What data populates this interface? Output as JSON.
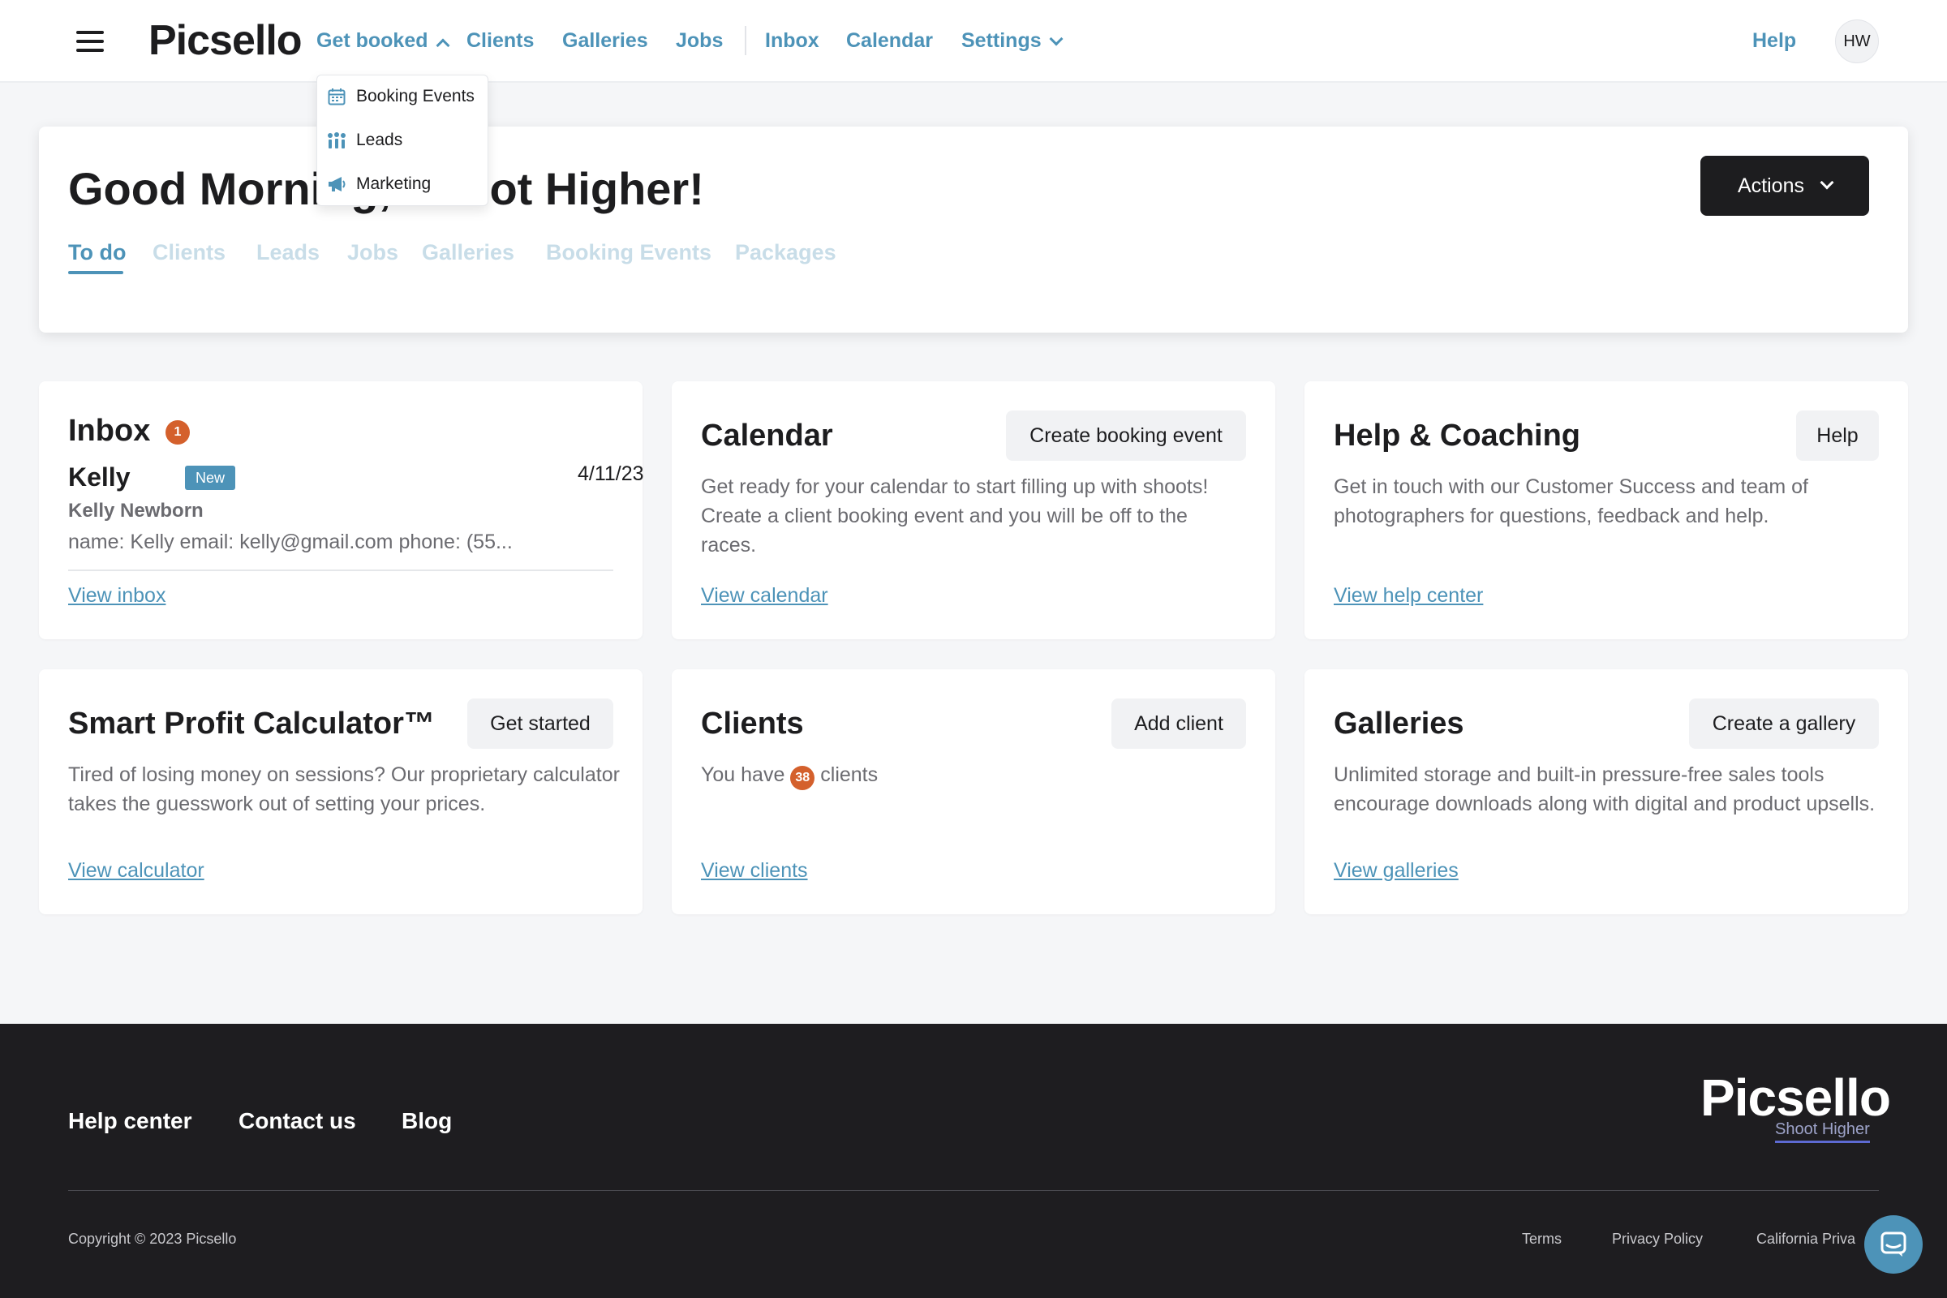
{
  "app": {
    "logo": "Picsello"
  },
  "nav": {
    "items": [
      {
        "label": "Get booked"
      },
      {
        "label": "Clients"
      },
      {
        "label": "Galleries"
      },
      {
        "label": "Jobs"
      },
      {
        "label": "Inbox"
      },
      {
        "label": "Calendar"
      },
      {
        "label": "Settings"
      }
    ],
    "help": "Help",
    "avatar_initials": "HW"
  },
  "dropdown": {
    "items": [
      {
        "label": "Booking Events",
        "icon": "calendar-icon"
      },
      {
        "label": "Leads",
        "icon": "leads-icon"
      },
      {
        "label": "Marketing",
        "icon": "megaphone-icon"
      }
    ]
  },
  "hero": {
    "greeting": "Good Morning, Shoot Higher!",
    "actions": "Actions",
    "tabs": [
      "To do",
      "Clients",
      "Leads",
      "Jobs",
      "Galleries",
      "Booking Events",
      "Packages"
    ]
  },
  "cards": {
    "inbox": {
      "title": "Inbox",
      "count": "1",
      "sender": "Kelly",
      "badge": "New",
      "date": "4/11/23",
      "subject": "Kelly Newborn",
      "preview": "name: Kelly email: kelly@gmail.com phone: (55...",
      "link": "View inbox"
    },
    "calendar": {
      "title": "Calendar",
      "button": "Create booking event",
      "text": "Get ready for your calendar to start filling up with shoots! Create a client booking event and you will be off to the races.",
      "link": "View calendar"
    },
    "help": {
      "title": "Help & Coaching",
      "button": "Help",
      "text": "Get in touch with our Customer Success and team of photographers for questions, feedback and help.",
      "link": "View help center"
    },
    "calculator": {
      "title": "Smart Profit Calculator™",
      "button": "Get started",
      "text": "Tired of losing money on sessions? Our proprietary calculator takes the guesswork out of setting your prices.",
      "link": "View calculator"
    },
    "clients": {
      "title": "Clients",
      "button": "Add client",
      "text_before": "You have",
      "count": "38",
      "text_after": "clients",
      "link": "View clients"
    },
    "galleries": {
      "title": "Galleries",
      "button": "Create a gallery",
      "text": "Unlimited storage and built-in pressure-free sales tools encourage downloads along with digital and product upsells.",
      "link": "View galleries"
    }
  },
  "footer": {
    "links": [
      "Help center",
      "Contact us",
      "Blog"
    ],
    "logo": "Picsello",
    "tagline": "Shoot Higher",
    "copyright": "Copyright © 2023 Picsello",
    "legal": [
      "Terms",
      "Privacy Policy",
      "California Priva"
    ]
  },
  "colors": {
    "accent": "#4d93b8",
    "badge": "#d4602c",
    "dark": "#1d1d1f",
    "footer": "#1e1d20"
  }
}
